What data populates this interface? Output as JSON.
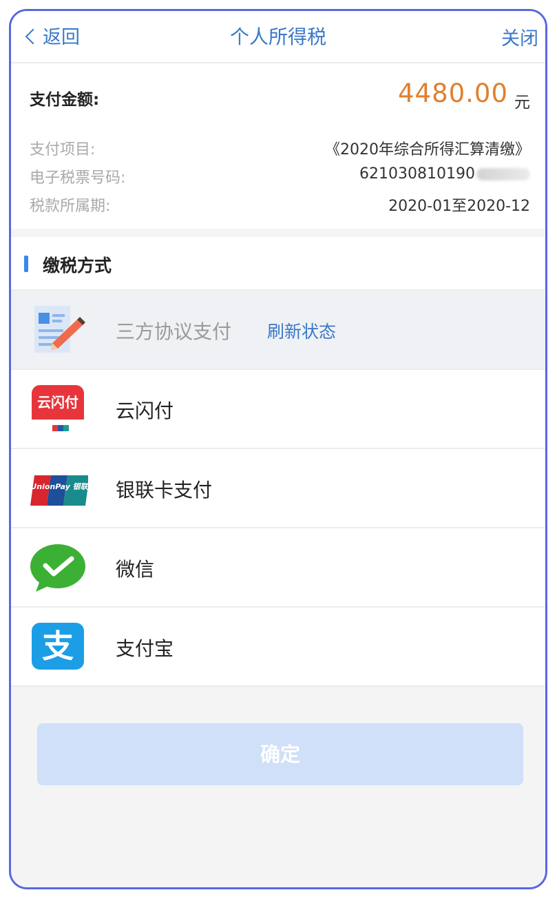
{
  "navbar": {
    "back_label": "返回",
    "title": "个人所得税",
    "close_label": "关闭"
  },
  "summary": {
    "amount_label": "支付金额:",
    "amount": "4480.00",
    "amount_unit": "元",
    "rows": [
      {
        "key": "支付项目:",
        "value": "《2020年综合所得汇算清缴》"
      },
      {
        "key": "电子税票号码:",
        "value": "621030810190"
      },
      {
        "key": "税款所属期:",
        "value": "2020-01至2020-12"
      }
    ]
  },
  "section": {
    "title": "缴税方式"
  },
  "methods": [
    {
      "label": "三方协议支付",
      "link": "刷新状态",
      "icon": "document-pencil-icon",
      "disabled": true
    },
    {
      "label": "云闪付",
      "icon": "unionpay-quickpass-icon",
      "icon_text": "云闪付"
    },
    {
      "label": "银联卡支付",
      "icon": "unionpay-card-icon",
      "icon_text": "UnionPay 银联"
    },
    {
      "label": "微信",
      "icon": "wechat-icon"
    },
    {
      "label": "支付宝",
      "icon": "alipay-icon",
      "icon_text": "支"
    }
  ],
  "confirm_label": "确定",
  "colors": {
    "accent": "#3a78c8",
    "amount": "#e0802e",
    "frame": "#5b67e0",
    "confirm_bg": "#cfe0f8"
  }
}
